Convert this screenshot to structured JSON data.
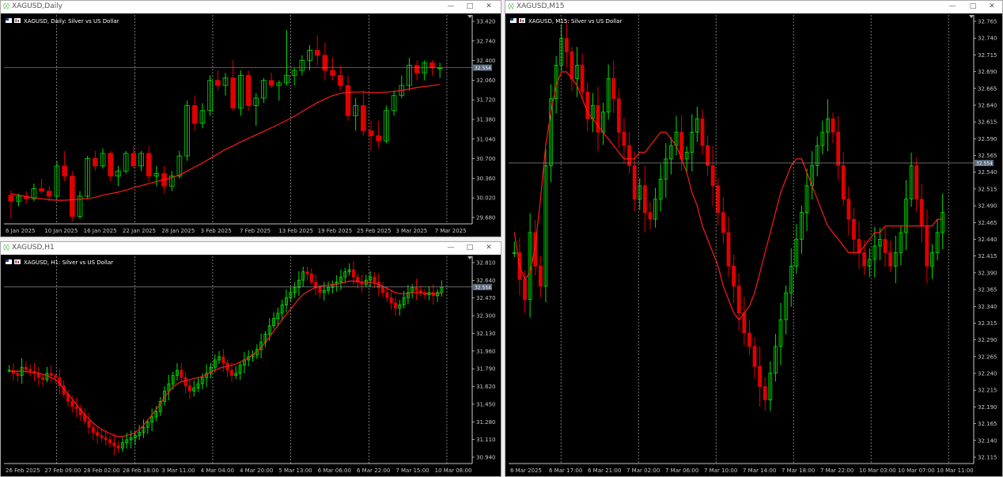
{
  "windows": [
    {
      "id": "daily",
      "title": "XAGUSD,Daily",
      "info": "XAGUSD, Daily:  Silver vs US Dollar",
      "price_label": "32.554",
      "yticks": [
        "33.420",
        "32.740",
        "32.400",
        "32.060",
        "31.720",
        "31.380",
        "31.040",
        "30.700",
        "30.360",
        "30.020",
        "29.680"
      ],
      "xticks": [
        "6 Jan 2025",
        "10 Jan 2025",
        "16 Jan 2025",
        "22 Jan 2025",
        "28 Jan 2025",
        "3 Feb 2025",
        "7 Feb 2025",
        "13 Feb 2025",
        "19 Feb 2025",
        "25 Feb 2025",
        "3 Mar 2025",
        "7 Mar 2025"
      ]
    },
    {
      "id": "h1",
      "title": "XAGUSD,H1",
      "info": "XAGUSD, H1:  Silver vs US Dollar",
      "price_label": "32.554",
      "yticks": [
        "32.810",
        "32.640",
        "32.470",
        "32.300",
        "32.130",
        "31.960",
        "31.790",
        "31.620",
        "31.450",
        "31.280",
        "31.110",
        "30.940"
      ],
      "xticks": [
        "26 Feb 2025",
        "27 Feb 09:00",
        "28 Feb 02:00",
        "28 Feb 18:00",
        "3 Mar 11:00",
        "4 Mar 04:00",
        "4 Mar 20:00",
        "5 Mar 13:00",
        "6 Mar 06:00",
        "6 Mar 22:00",
        "7 Mar 15:00",
        "10 Mar 08:00"
      ]
    },
    {
      "id": "m15",
      "title": "XAGUSD,M15",
      "info": "XAGUSD, M15:  Silver vs US Dollar",
      "price_label": "32.554",
      "yticks": [
        "32.765",
        "32.740",
        "32.715",
        "32.690",
        "32.665",
        "32.640",
        "32.615",
        "32.590",
        "32.565",
        "32.540",
        "32.515",
        "32.490",
        "32.465",
        "32.440",
        "32.415",
        "32.390",
        "32.365",
        "32.340",
        "32.315",
        "32.290",
        "32.265",
        "32.240",
        "32.215",
        "32.190",
        "32.165",
        "32.140",
        "32.115"
      ],
      "xticks": [
        "6 Mar 2025",
        "6 Mar 17:00",
        "6 Mar 21:00",
        "7 Mar 02:00",
        "7 Mar 06:00",
        "7 Mar 10:00",
        "7 Mar 14:00",
        "7 Mar 18:00",
        "7 Mar 22:00",
        "10 Mar 03:00",
        "10 Mar 07:00",
        "10 Mar 11:00"
      ]
    }
  ],
  "window_buttons": {
    "minimize": "—",
    "maximize": "□",
    "close": "✕"
  },
  "colors": {
    "bull": "#00e000",
    "bear": "#e00000",
    "ma": "#ff1a1a",
    "grid": "#c8c8c8",
    "bg": "#000000",
    "axis_text": "#c8c8c8"
  },
  "chart_data": [
    {
      "type": "candlestick",
      "symbol": "XAGUSD",
      "timeframe": "Daily",
      "title": "XAGUSD, Daily:  Silver vs US Dollar",
      "ylim": [
        29.45,
        33.6
      ],
      "current_price": 32.554,
      "ohlc": [
        [
          30.02,
          30.12,
          29.55,
          29.9
        ],
        [
          29.9,
          30.05,
          29.8,
          30.0
        ],
        [
          30.0,
          30.1,
          29.85,
          29.95
        ],
        [
          29.95,
          30.25,
          29.9,
          30.15
        ],
        [
          30.15,
          30.35,
          30.05,
          30.1
        ],
        [
          30.1,
          30.2,
          29.9,
          30.0
        ],
        [
          30.0,
          30.7,
          29.95,
          30.6
        ],
        [
          30.6,
          30.9,
          30.3,
          30.4
        ],
        [
          30.4,
          30.5,
          29.5,
          29.6
        ],
        [
          29.6,
          30.1,
          29.55,
          30.0
        ],
        [
          30.0,
          30.8,
          29.95,
          30.75
        ],
        [
          30.75,
          30.9,
          30.5,
          30.6
        ],
        [
          30.6,
          30.95,
          30.55,
          30.85
        ],
        [
          30.85,
          30.9,
          30.3,
          30.4
        ],
        [
          30.4,
          30.6,
          30.2,
          30.5
        ],
        [
          30.5,
          30.9,
          30.45,
          30.85
        ],
        [
          30.85,
          31.0,
          30.55,
          30.6
        ],
        [
          30.6,
          30.9,
          30.5,
          30.85
        ],
        [
          30.85,
          31.0,
          30.3,
          30.4
        ],
        [
          30.4,
          30.6,
          30.2,
          30.45
        ],
        [
          30.45,
          30.6,
          30.05,
          30.2
        ],
        [
          30.2,
          30.5,
          30.1,
          30.4
        ],
        [
          30.4,
          30.9,
          30.35,
          30.8
        ],
        [
          30.8,
          31.9,
          30.7,
          31.8
        ],
        [
          31.8,
          32.0,
          31.3,
          31.45
        ],
        [
          31.45,
          31.85,
          31.35,
          31.7
        ],
        [
          31.7,
          32.4,
          31.6,
          32.3
        ],
        [
          32.3,
          32.5,
          32.1,
          32.2
        ],
        [
          32.2,
          32.45,
          32.0,
          32.35
        ],
        [
          32.35,
          32.7,
          31.7,
          31.75
        ],
        [
          31.75,
          32.5,
          31.6,
          32.4
        ],
        [
          32.4,
          32.5,
          31.7,
          31.8
        ],
        [
          31.8,
          32.05,
          31.4,
          31.95
        ],
        [
          31.95,
          32.35,
          31.85,
          32.3
        ],
        [
          32.3,
          32.45,
          32.15,
          32.2
        ],
        [
          32.2,
          32.3,
          31.9,
          32.25
        ],
        [
          32.25,
          33.3,
          32.2,
          32.4
        ],
        [
          32.4,
          32.55,
          32.2,
          32.5
        ],
        [
          32.5,
          32.8,
          32.4,
          32.7
        ],
        [
          32.7,
          33.0,
          32.5,
          32.9
        ],
        [
          32.9,
          33.2,
          32.6,
          32.8
        ],
        [
          32.8,
          33.05,
          32.3,
          32.5
        ],
        [
          32.5,
          32.75,
          32.3,
          32.4
        ],
        [
          32.4,
          32.6,
          32.1,
          32.2
        ],
        [
          32.2,
          32.4,
          31.5,
          31.6
        ],
        [
          31.6,
          31.95,
          31.3,
          31.8
        ],
        [
          31.8,
          32.1,
          31.2,
          31.3
        ],
        [
          31.3,
          31.5,
          30.9,
          31.2
        ],
        [
          31.2,
          31.5,
          30.95,
          31.1
        ],
        [
          31.1,
          31.8,
          31.05,
          31.7
        ],
        [
          31.7,
          32.1,
          31.6,
          32.0
        ],
        [
          32.0,
          32.4,
          31.95,
          32.2
        ],
        [
          32.2,
          32.75,
          32.1,
          32.6
        ],
        [
          32.6,
          32.7,
          32.3,
          32.45
        ],
        [
          32.45,
          32.7,
          32.3,
          32.65
        ],
        [
          32.65,
          32.7,
          32.4,
          32.55
        ],
        [
          32.55,
          32.65,
          32.35,
          32.55
        ]
      ],
      "ma": [
        30.05,
        30.02,
        29.99,
        29.97,
        29.95,
        29.93,
        29.92,
        29.92,
        29.93,
        29.94,
        29.95,
        29.98,
        30.02,
        30.05,
        30.08,
        30.12,
        30.17,
        30.21,
        30.25,
        30.29,
        30.33,
        30.37,
        30.42,
        30.5,
        30.58,
        30.66,
        30.75,
        30.84,
        30.93,
        31.0,
        31.08,
        31.15,
        31.22,
        31.29,
        31.36,
        31.43,
        31.51,
        31.59,
        31.68,
        31.77,
        31.86,
        31.93,
        32.0,
        32.04,
        32.06,
        32.07,
        32.07,
        32.06,
        32.06,
        32.07,
        32.08,
        32.1,
        32.13,
        32.16,
        32.18,
        32.2,
        32.22
      ]
    },
    {
      "type": "candlestick",
      "symbol": "XAGUSD",
      "timeframe": "H1",
      "title": "XAGUSD, H1:  Silver vs US Dollar",
      "ylim": [
        30.85,
        32.85
      ],
      "current_price": 32.554,
      "close": [
        31.75,
        31.72,
        31.7,
        31.78,
        31.76,
        31.74,
        31.72,
        31.68,
        31.66,
        31.72,
        31.7,
        31.68,
        31.6,
        31.52,
        31.45,
        31.4,
        31.38,
        31.32,
        31.26,
        31.2,
        31.15,
        31.12,
        31.1,
        31.08,
        31.05,
        31.02,
        31.0,
        31.05,
        31.08,
        31.1,
        31.12,
        31.15,
        31.2,
        31.25,
        31.3,
        31.35,
        31.45,
        31.55,
        31.62,
        31.7,
        31.75,
        31.68,
        31.6,
        31.55,
        31.58,
        31.62,
        31.68,
        31.72,
        31.78,
        31.85,
        31.88,
        31.82,
        31.75,
        31.7,
        31.72,
        31.8,
        31.85,
        31.88,
        31.9,
        31.95,
        32.02,
        32.1,
        32.18,
        32.25,
        32.3,
        32.38,
        32.45,
        32.5,
        32.55,
        32.62,
        32.7,
        32.68,
        32.6,
        32.55,
        32.5,
        32.52,
        32.55,
        32.58,
        32.6,
        32.65,
        32.7,
        32.72,
        32.65,
        32.6,
        32.58,
        32.62,
        32.65,
        32.6,
        32.55,
        32.5,
        32.45,
        32.4,
        32.35,
        32.38,
        32.45,
        32.5,
        32.55,
        32.52,
        32.5,
        32.48,
        32.5,
        32.47,
        32.5,
        32.55
      ],
      "ma": [
        31.74,
        31.74,
        31.74,
        31.74,
        31.74,
        31.73,
        31.73,
        31.72,
        31.71,
        31.7,
        31.68,
        31.66,
        31.62,
        31.57,
        31.52,
        31.47,
        31.42,
        31.37,
        31.32,
        31.28,
        31.24,
        31.21,
        31.18,
        31.16,
        31.14,
        31.12,
        31.11,
        31.11,
        31.12,
        31.13,
        31.15,
        31.18,
        31.22,
        31.27,
        31.32,
        31.37,
        31.43,
        31.49,
        31.54,
        31.59,
        31.62,
        31.64,
        31.65,
        31.66,
        31.67,
        31.68,
        31.69,
        31.71,
        31.73,
        31.75,
        31.77,
        31.78,
        31.79,
        31.8,
        31.81,
        31.83,
        31.85,
        31.87,
        31.9,
        31.93,
        31.97,
        32.02,
        32.07,
        32.13,
        32.18,
        32.24,
        32.29,
        32.34,
        32.39,
        32.44,
        32.48,
        32.51,
        32.53,
        32.55,
        32.56,
        32.57,
        32.57,
        32.58,
        32.58,
        32.59,
        32.6,
        32.61,
        32.61,
        32.61,
        32.6,
        32.6,
        32.6,
        32.59,
        32.58,
        32.56,
        32.54,
        32.52,
        32.5,
        32.49,
        32.49,
        32.49,
        32.5,
        32.5,
        32.5,
        32.49,
        32.49,
        32.49,
        32.49,
        32.5
      ]
    },
    {
      "type": "candlestick",
      "symbol": "XAGUSD",
      "timeframe": "M15",
      "title": "XAGUSD, M15:  Silver vs US Dollar",
      "ylim": [
        32.105,
        32.775
      ],
      "current_price": 32.554,
      "close": [
        32.42,
        32.38,
        32.35,
        32.45,
        32.4,
        32.37,
        32.55,
        32.65,
        32.7,
        32.74,
        32.72,
        32.68,
        32.7,
        32.66,
        32.62,
        32.64,
        32.6,
        32.63,
        32.68,
        32.65,
        32.6,
        32.58,
        32.55,
        32.5,
        32.52,
        32.48,
        32.47,
        32.5,
        32.53,
        32.56,
        32.58,
        32.6,
        32.56,
        32.57,
        32.6,
        32.62,
        32.58,
        32.55,
        32.52,
        32.48,
        32.45,
        32.4,
        32.37,
        32.33,
        32.3,
        32.28,
        32.25,
        32.22,
        32.2,
        32.24,
        32.28,
        32.32,
        32.36,
        32.4,
        32.44,
        32.48,
        32.52,
        32.55,
        32.58,
        32.6,
        32.62,
        32.6,
        32.55,
        32.5,
        32.47,
        32.44,
        32.42,
        32.4,
        32.41,
        32.43,
        32.44,
        32.42,
        32.4,
        32.42,
        32.45,
        32.5,
        32.55,
        32.5,
        32.46,
        32.4,
        32.42,
        32.45,
        32.48
      ],
      "ma": [
        32.45,
        32.4,
        32.38,
        32.39,
        32.43,
        32.5,
        32.58,
        32.63,
        32.67,
        32.69,
        32.69,
        32.68,
        32.67,
        32.65,
        32.63,
        32.62,
        32.61,
        32.6,
        32.59,
        32.58,
        32.57,
        32.56,
        32.56,
        32.56,
        32.57,
        32.57,
        32.58,
        32.59,
        32.6,
        32.6,
        32.59,
        32.58,
        32.56,
        32.54,
        32.51,
        32.49,
        32.46,
        32.44,
        32.42,
        32.4,
        32.37,
        32.35,
        32.33,
        32.32,
        32.33,
        32.34,
        32.36,
        32.39,
        32.42,
        32.45,
        32.48,
        32.51,
        32.53,
        32.55,
        32.56,
        32.56,
        32.54,
        32.52,
        32.5,
        32.48,
        32.46,
        32.45,
        32.44,
        32.43,
        32.42,
        32.42,
        32.42,
        32.43,
        32.44,
        32.45,
        32.45,
        32.46,
        32.46,
        32.46,
        32.46,
        32.46,
        32.46,
        32.46,
        32.46,
        32.46,
        32.46,
        32.47,
        32.47
      ]
    }
  ]
}
